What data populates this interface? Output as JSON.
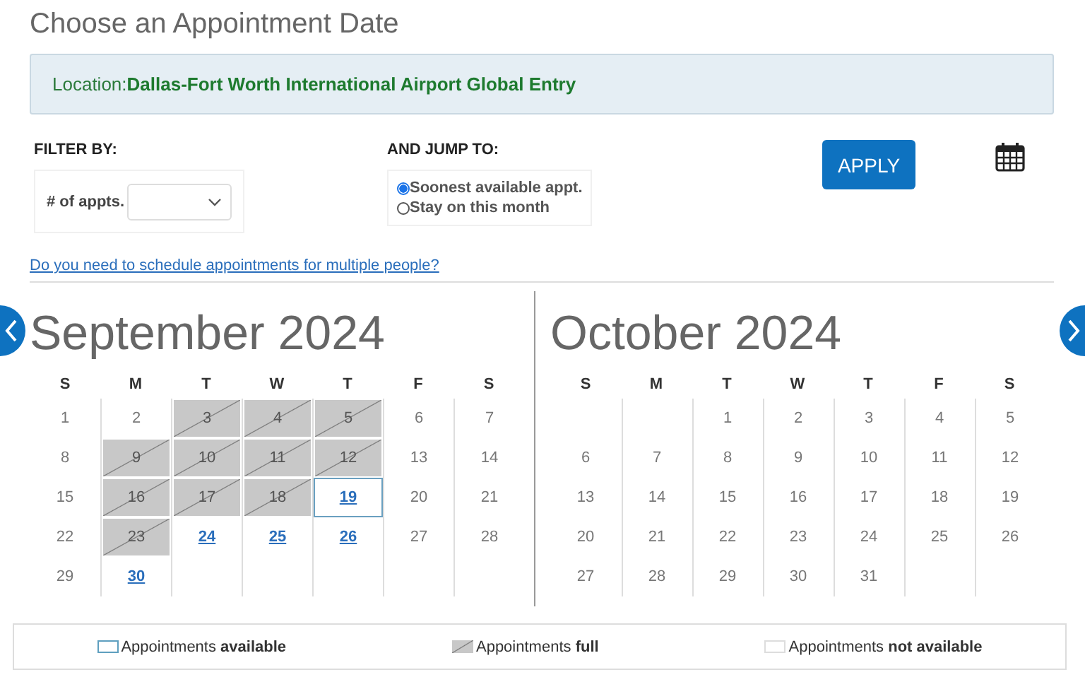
{
  "page_title": "Choose an Appointment Date",
  "location": {
    "label": "Location:",
    "value": "Dallas-Fort Worth International Airport Global Entry"
  },
  "filter": {
    "heading": "FILTER BY:",
    "field_label": "# of appts."
  },
  "jump": {
    "heading": "AND JUMP TO:",
    "options": [
      {
        "label": "Soonest available appt.",
        "selected": true
      },
      {
        "label": "Stay on this month",
        "selected": false
      }
    ]
  },
  "apply_button": "APPLY",
  "multiple_people_link": "Do you need to schedule appointments for multiple people?",
  "months": [
    {
      "title": "September 2024",
      "weekdays": [
        "S",
        "M",
        "T",
        "W",
        "T",
        "F",
        "S"
      ],
      "weeks": [
        [
          {
            "day": "1",
            "kind": "none",
            "selected": false
          },
          {
            "day": "2",
            "kind": "none",
            "selected": false
          },
          {
            "day": "3",
            "kind": "full",
            "selected": false
          },
          {
            "day": "4",
            "kind": "full",
            "selected": false
          },
          {
            "day": "5",
            "kind": "full",
            "selected": false
          },
          {
            "day": "6",
            "kind": "none",
            "selected": false
          },
          {
            "day": "7",
            "kind": "none",
            "selected": false
          }
        ],
        [
          {
            "day": "8",
            "kind": "none",
            "selected": false
          },
          {
            "day": "9",
            "kind": "full",
            "selected": false
          },
          {
            "day": "10",
            "kind": "full",
            "selected": false
          },
          {
            "day": "11",
            "kind": "full",
            "selected": false
          },
          {
            "day": "12",
            "kind": "full",
            "selected": false
          },
          {
            "day": "13",
            "kind": "none",
            "selected": false
          },
          {
            "day": "14",
            "kind": "none",
            "selected": false
          }
        ],
        [
          {
            "day": "15",
            "kind": "none",
            "selected": false
          },
          {
            "day": "16",
            "kind": "full",
            "selected": false
          },
          {
            "day": "17",
            "kind": "full",
            "selected": false
          },
          {
            "day": "18",
            "kind": "full",
            "selected": false
          },
          {
            "day": "19",
            "kind": "available",
            "selected": true
          },
          {
            "day": "20",
            "kind": "none",
            "selected": false
          },
          {
            "day": "21",
            "kind": "none",
            "selected": false
          }
        ],
        [
          {
            "day": "22",
            "kind": "none",
            "selected": false
          },
          {
            "day": "23",
            "kind": "full",
            "selected": false
          },
          {
            "day": "24",
            "kind": "available",
            "selected": false
          },
          {
            "day": "25",
            "kind": "available",
            "selected": false
          },
          {
            "day": "26",
            "kind": "available",
            "selected": false
          },
          {
            "day": "27",
            "kind": "none",
            "selected": false
          },
          {
            "day": "28",
            "kind": "none",
            "selected": false
          }
        ],
        [
          {
            "day": "29",
            "kind": "none",
            "selected": false
          },
          {
            "day": "30",
            "kind": "available",
            "selected": false
          },
          {
            "kind": "blank"
          },
          {
            "kind": "blank"
          },
          {
            "kind": "blank"
          },
          {
            "kind": "blank"
          },
          {
            "kind": "blank"
          }
        ]
      ]
    },
    {
      "title": "October 2024",
      "weekdays": [
        "S",
        "M",
        "T",
        "W",
        "T",
        "F",
        "S"
      ],
      "weeks": [
        [
          {
            "kind": "blank"
          },
          {
            "kind": "blank"
          },
          {
            "day": "1",
            "kind": "none",
            "selected": false
          },
          {
            "day": "2",
            "kind": "none",
            "selected": false
          },
          {
            "day": "3",
            "kind": "none",
            "selected": false
          },
          {
            "day": "4",
            "kind": "none",
            "selected": false
          },
          {
            "day": "5",
            "kind": "none",
            "selected": false
          }
        ],
        [
          {
            "day": "6",
            "kind": "none",
            "selected": false
          },
          {
            "day": "7",
            "kind": "none",
            "selected": false
          },
          {
            "day": "8",
            "kind": "none",
            "selected": false
          },
          {
            "day": "9",
            "kind": "none",
            "selected": false
          },
          {
            "day": "10",
            "kind": "none",
            "selected": false
          },
          {
            "day": "11",
            "kind": "none",
            "selected": false
          },
          {
            "day": "12",
            "kind": "none",
            "selected": false
          }
        ],
        [
          {
            "day": "13",
            "kind": "none",
            "selected": false
          },
          {
            "day": "14",
            "kind": "none",
            "selected": false
          },
          {
            "day": "15",
            "kind": "none",
            "selected": false
          },
          {
            "day": "16",
            "kind": "none",
            "selected": false
          },
          {
            "day": "17",
            "kind": "none",
            "selected": false
          },
          {
            "day": "18",
            "kind": "none",
            "selected": false
          },
          {
            "day": "19",
            "kind": "none",
            "selected": false
          }
        ],
        [
          {
            "day": "20",
            "kind": "none",
            "selected": false
          },
          {
            "day": "21",
            "kind": "none",
            "selected": false
          },
          {
            "day": "22",
            "kind": "none",
            "selected": false
          },
          {
            "day": "23",
            "kind": "none",
            "selected": false
          },
          {
            "day": "24",
            "kind": "none",
            "selected": false
          },
          {
            "day": "25",
            "kind": "none",
            "selected": false
          },
          {
            "day": "26",
            "kind": "none",
            "selected": false
          }
        ],
        [
          {
            "day": "27",
            "kind": "none",
            "selected": false
          },
          {
            "day": "28",
            "kind": "none",
            "selected": false
          },
          {
            "day": "29",
            "kind": "none",
            "selected": false
          },
          {
            "day": "30",
            "kind": "none",
            "selected": false
          },
          {
            "day": "31",
            "kind": "none",
            "selected": false
          },
          {
            "kind": "blank"
          },
          {
            "kind": "blank"
          }
        ]
      ]
    }
  ],
  "legend": [
    {
      "kind": "available",
      "text": "Appointments **available**"
    },
    {
      "kind": "full",
      "text": "Appointments **full**"
    },
    {
      "kind": "none",
      "text": "Appointments **not available**"
    }
  ]
}
